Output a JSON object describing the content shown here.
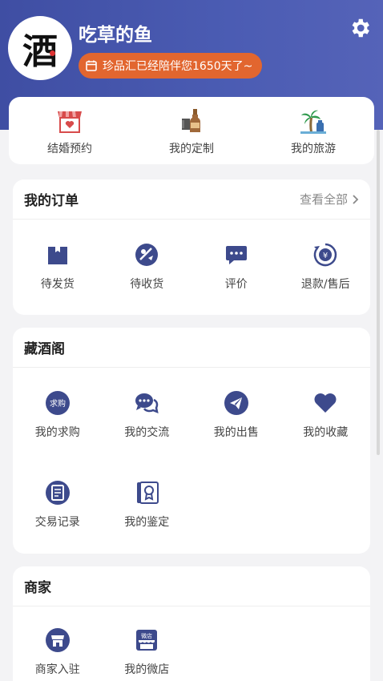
{
  "profile": {
    "avatar_char": "酒",
    "username": "吃草的鱼",
    "companion_text": "珍品汇已经陪伴您1650天了~"
  },
  "quick_links": [
    {
      "label": "结婚预约",
      "icon": "wedding-shop-icon"
    },
    {
      "label": "我的定制",
      "icon": "custom-bottle-icon"
    },
    {
      "label": "我的旅游",
      "icon": "palm-tree-icon"
    }
  ],
  "orders": {
    "title": "我的订单",
    "view_all": "查看全部",
    "items": [
      {
        "label": "待发货",
        "icon": "box-icon"
      },
      {
        "label": "待收货",
        "icon": "delivery-icon"
      },
      {
        "label": "评价",
        "icon": "comment-icon"
      },
      {
        "label": "退款/售后",
        "icon": "refund-icon"
      }
    ]
  },
  "cellar": {
    "title": "藏酒阁",
    "items": [
      {
        "label": "我的求购",
        "icon": "want-buy-icon",
        "badge": "求购"
      },
      {
        "label": "我的交流",
        "icon": "chat-icon"
      },
      {
        "label": "我的出售",
        "icon": "send-icon"
      },
      {
        "label": "我的收藏",
        "icon": "heart-icon"
      },
      {
        "label": "交易记录",
        "icon": "record-icon"
      },
      {
        "label": "我的鉴定",
        "icon": "certificate-icon"
      }
    ]
  },
  "merchant": {
    "title": "商家",
    "items": [
      {
        "label": "商家入驻",
        "icon": "store-join-icon"
      },
      {
        "label": "我的微店",
        "icon": "micro-shop-icon",
        "badge": "微店"
      }
    ]
  },
  "colors": {
    "primary": "#3f4ea3",
    "accent": "#e2662f",
    "icon": "#3d4a8c"
  }
}
